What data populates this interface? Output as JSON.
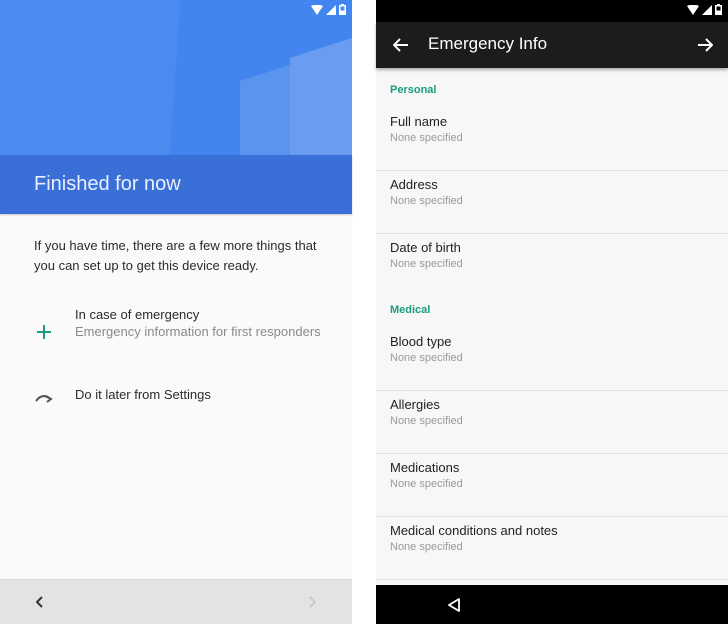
{
  "left": {
    "title": "Finished for now",
    "intro": "If you have time, there are a few more things that you can set up to get this device ready.",
    "options": [
      {
        "icon": "plus-icon",
        "title": "In case of emergency",
        "subtitle": "Emergency information for first responders"
      },
      {
        "icon": "redo-arrow-icon",
        "title": "Do it later from Settings",
        "subtitle": ""
      }
    ],
    "nav": {
      "back_icon": "chevron-left-icon",
      "next_icon": "chevron-right-icon"
    },
    "colors": {
      "hero": "#4a8bf0",
      "band": "#3b6fd8",
      "accent": "#1a9c7e"
    }
  },
  "right": {
    "toolbar": {
      "title": "Emergency Info",
      "back_icon": "arrow-left-icon",
      "next_icon": "arrow-right-icon"
    },
    "sections": [
      {
        "label": "Personal",
        "items": [
          {
            "title": "Full name",
            "value": "None specified"
          },
          {
            "title": "Address",
            "value": "None specified"
          },
          {
            "title": "Date of birth",
            "value": "None specified"
          }
        ]
      },
      {
        "label": "Medical",
        "items": [
          {
            "title": "Blood type",
            "value": "None specified"
          },
          {
            "title": "Allergies",
            "value": "None specified"
          },
          {
            "title": "Medications",
            "value": "None specified"
          },
          {
            "title": "Medical conditions and notes",
            "value": "None specified"
          }
        ]
      }
    ],
    "nav": {
      "back_icon": "triangle-back-icon"
    },
    "colors": {
      "section": "#1a9c7e",
      "toolbar": "#1c1c1c"
    }
  }
}
